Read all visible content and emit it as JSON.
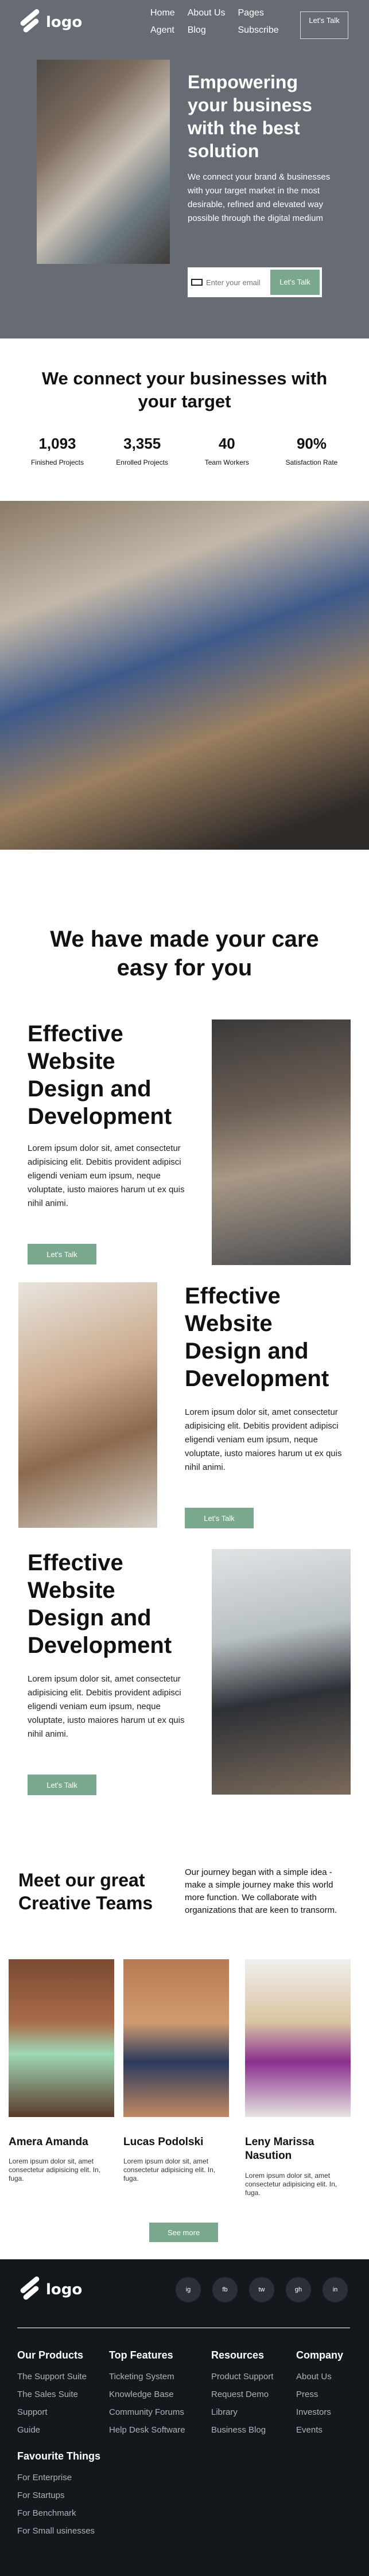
{
  "brand": {
    "logo_text": "logo"
  },
  "nav": {
    "items": [
      "Home",
      "About Us",
      "Pages",
      "Agent",
      "Blog",
      "Subscribe"
    ],
    "cta": "Let's Talk"
  },
  "hero": {
    "title": "Empowering your business with the best solution",
    "description": "We connect your brand & businesses with your target market in the most desirable, refined and elevated way possible through the digital medium",
    "email_placeholder": "Enter your email",
    "email_button": "Let's Talk"
  },
  "stats": {
    "title": "We connect your businesses with your target",
    "items": [
      {
        "value": "1,093",
        "label": "Finished Projects"
      },
      {
        "value": "3,355",
        "label": "Enrolled Projects"
      },
      {
        "value": "40",
        "label": "Team Workers"
      },
      {
        "value": "90%",
        "label": "Satisfaction Rate"
      }
    ]
  },
  "services": {
    "title": "We have made your care easy for you",
    "blocks": [
      {
        "title": "Effective Website Design and Development",
        "text": "Lorem ipsum dolor sit, amet consectetur adipisicing elit. Debitis provident adipisci eligendi veniam eum ipsum, neque voluptate, iusto maiores harum ut ex quis nihil animi.",
        "button": "Let's Talk"
      },
      {
        "title": "Effective Website Design and Development",
        "text": "Lorem ipsum dolor sit, amet consectetur adipisicing elit. Debitis provident adipisci eligendi veniam eum ipsum, neque voluptate, iusto maiores harum ut ex quis nihil animi.",
        "button": "Let's Talk"
      },
      {
        "title": "Effective Website Design and Development",
        "text": "Lorem ipsum dolor sit, amet consectetur adipisicing elit. Debitis provident adipisci eligendi veniam eum ipsum, neque voluptate, iusto maiores harum ut ex quis nihil animi.",
        "button": "Let's Talk"
      }
    ]
  },
  "team": {
    "title": "Meet our great Creative Teams",
    "description": "Our journey began with a simple idea - make a simple journey make this world more function. We collaborate with organizations that are keen to transorm.",
    "members": [
      {
        "name": "Amera Amanda",
        "desc": "Lorem ipsum dolor sit, amet consectetur adipisicing elit. In, fuga."
      },
      {
        "name": "Lucas Podolski",
        "desc": "Lorem ipsum dolor sit, amet consectetur adipisicing elit. In, fuga."
      },
      {
        "name": "Leny Marissa Nasution",
        "desc": "Lorem ipsum dolor sit, amet consectetur adipisicing elit. In, fuga."
      }
    ],
    "more_button": "See more"
  },
  "footer": {
    "logo_text": "logo",
    "socials": [
      "ig",
      "fb",
      "tw",
      "gh",
      "in"
    ],
    "columns": [
      {
        "title": "Our Products",
        "items": [
          "The Support Suite",
          "The Sales Suite",
          "Support",
          "Guide"
        ]
      },
      {
        "title": "Top Features",
        "items": [
          "Ticketing System",
          "Knowledge Base",
          "Community Forums",
          "Help Desk Software"
        ]
      },
      {
        "title": "Resources",
        "items": [
          "Product Support",
          "Request Demo",
          "Library",
          "Business Blog"
        ]
      },
      {
        "title": "Company",
        "items": [
          "About Us",
          "Press",
          "Investors",
          "Events"
        ]
      }
    ],
    "favourite": {
      "title": "Favourite Things",
      "items": [
        "For Enterprise",
        "For Startups",
        "For Benchmark",
        "For Small usinesses"
      ]
    }
  },
  "colors": {
    "hero_bg": "#666b74",
    "accent": "#7aa88f",
    "footer_bg": "#13181d"
  }
}
